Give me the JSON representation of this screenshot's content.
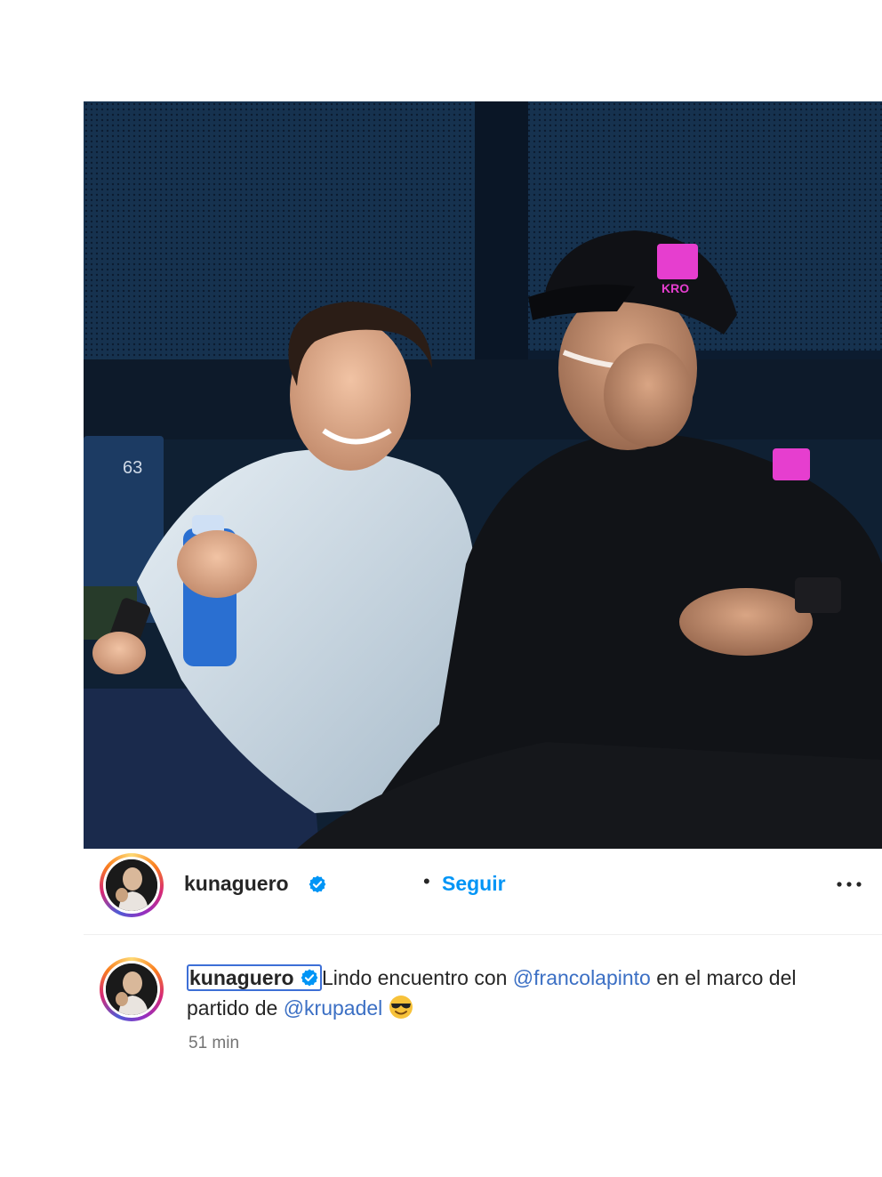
{
  "post": {
    "photo_description_icon": "photo-image",
    "author": {
      "username": "kunaguero",
      "verified": true,
      "separator": "•",
      "follow_label": "Seguir"
    },
    "more_icon": "more-horizontal-icon",
    "caption": {
      "username": "kunaguero",
      "text_1": "Lindo encuentro con ",
      "mention_1": "@francolapinto",
      "text_2": " en el marco del partido de ",
      "mention_2": "@krupadel",
      "emoji": "smiling-face-with-sunglasses-icon"
    },
    "timestamp": "51 min",
    "photo_text": {
      "seat_number": "63",
      "cap_logo": "KRO"
    }
  },
  "colors": {
    "link": "#0095f6",
    "mention": "#3b6fc4",
    "verified": "#0095f6",
    "timestamp": "#737373"
  }
}
